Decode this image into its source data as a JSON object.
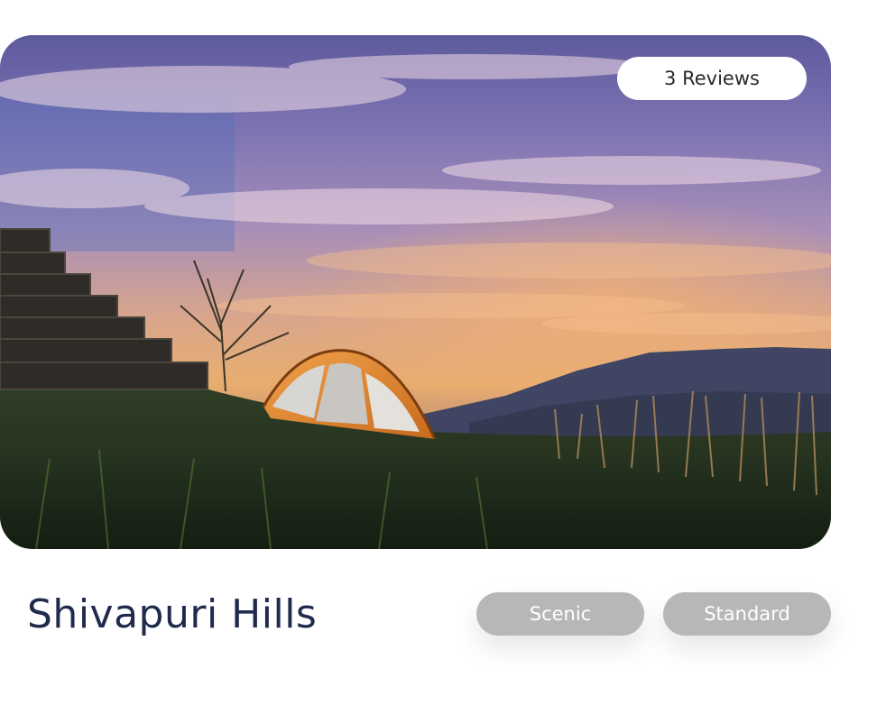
{
  "card": {
    "title": "Shivapuri Hills",
    "reviews_label": "3 Reviews",
    "tags": [
      "Scenic",
      "Standard"
    ]
  },
  "colors": {
    "title": "#1f2a4d",
    "tag_background": "#b7b7b7",
    "tag_text": "#ffffff",
    "badge_background": "#ffffff"
  }
}
